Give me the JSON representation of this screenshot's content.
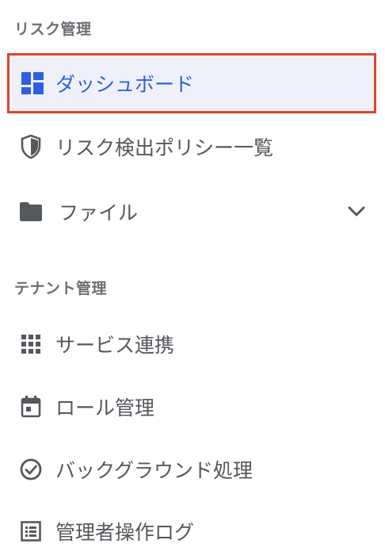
{
  "sections": {
    "risk": {
      "title": "リスク管理",
      "items": [
        {
          "label": "ダッシュボード",
          "icon": "dashboard-icon",
          "active": true
        },
        {
          "label": "リスク検出ポリシー一覧",
          "icon": "shield-icon"
        },
        {
          "label": "ファイル",
          "icon": "folder-icon",
          "expandable": true
        }
      ]
    },
    "tenant": {
      "title": "テナント管理",
      "items": [
        {
          "label": "サービス連携",
          "icon": "grid-icon"
        },
        {
          "label": "ロール管理",
          "icon": "calendar-icon"
        },
        {
          "label": "バックグラウンド処理",
          "icon": "check-circle-icon"
        },
        {
          "label": "管理者操作ログ",
          "icon": "list-icon"
        }
      ]
    }
  },
  "colors": {
    "accent": "#2f5fe0",
    "active_bg": "#eff0fa",
    "active_border": "#e0432e",
    "text": "#55585d"
  }
}
